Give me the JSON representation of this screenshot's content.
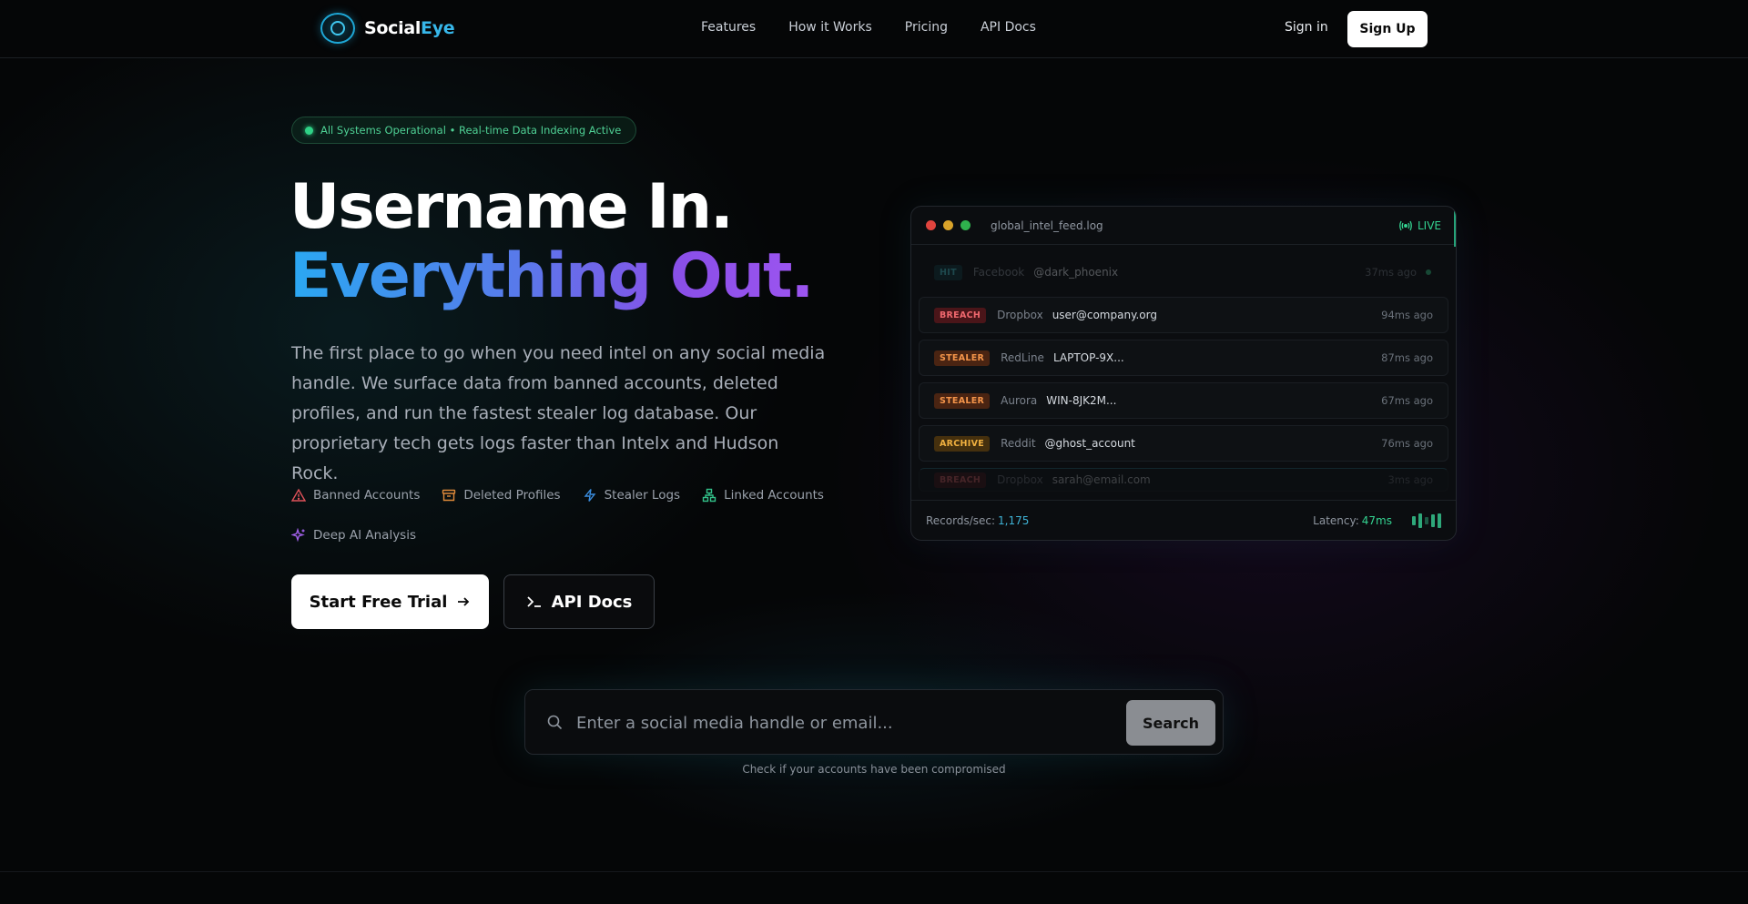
{
  "brand": {
    "name_a": "Social",
    "name_b": "Eye"
  },
  "nav": {
    "links": [
      "Features",
      "How it Works",
      "Pricing",
      "API Docs"
    ],
    "signin": "Sign in",
    "signup": "Sign Up"
  },
  "status": {
    "text": "All Systems Operational • Real-time Data Indexing Active"
  },
  "hero": {
    "line1": "Username In.",
    "line2": "Everything Out.",
    "description": "The first place to go when you need intel on any social media handle. We surface data from banned accounts, deleted profiles, and run the fastest stealer log database. Our proprietary tech gets logs faster than Intelx and Hudson Rock.",
    "features": [
      {
        "label": "Banned Accounts",
        "icon": "warning-triangle-icon",
        "color": "#e0525a"
      },
      {
        "label": "Deleted Profiles",
        "icon": "archive-box-icon",
        "color": "#e08a3a"
      },
      {
        "label": "Stealer Logs",
        "icon": "lightning-icon",
        "color": "#3a8ee0"
      },
      {
        "label": "Linked Accounts",
        "icon": "network-icon",
        "color": "#33c28a"
      },
      {
        "label": "Deep AI Analysis",
        "icon": "sparkles-icon",
        "color": "#a060e8"
      }
    ],
    "cta_primary": "Start Free Trial",
    "cta_secondary": "API Docs"
  },
  "terminal": {
    "filename": "global_intel_feed.log",
    "live": "LIVE",
    "rows": [
      {
        "tag": "HIT",
        "type": "hit",
        "source": "Facebook",
        "value": "@dark_phoenix",
        "time": "37ms ago"
      },
      {
        "tag": "BREACH",
        "type": "breach",
        "source": "Dropbox",
        "value": "user@company.org",
        "time": "94ms ago"
      },
      {
        "tag": "STEALER",
        "type": "stealer",
        "source": "RedLine",
        "value": "LAPTOP-9X...",
        "time": "87ms ago"
      },
      {
        "tag": "STEALER",
        "type": "stealer",
        "source": "Aurora",
        "value": "WIN-8JK2M...",
        "time": "67ms ago"
      },
      {
        "tag": "ARCHIVE",
        "type": "archive",
        "source": "Reddit",
        "value": "@ghost_account",
        "time": "76ms ago"
      },
      {
        "tag": "BREACH",
        "type": "breach",
        "source": "Dropbox",
        "value": "sarah@email.com",
        "time": "3ms ago"
      }
    ],
    "records_label": "Records/sec:",
    "records_value": "1,175",
    "latency_label": "Latency:",
    "latency_value": "47ms"
  },
  "search": {
    "placeholder": "Enter a social media handle or email...",
    "value": "",
    "button": "Search",
    "hint": "Check if your accounts have been compromised"
  },
  "colors": {
    "accent_cyan": "#37b7ea",
    "accent_purple": "#9d55f0",
    "status_green": "#2fd286"
  }
}
